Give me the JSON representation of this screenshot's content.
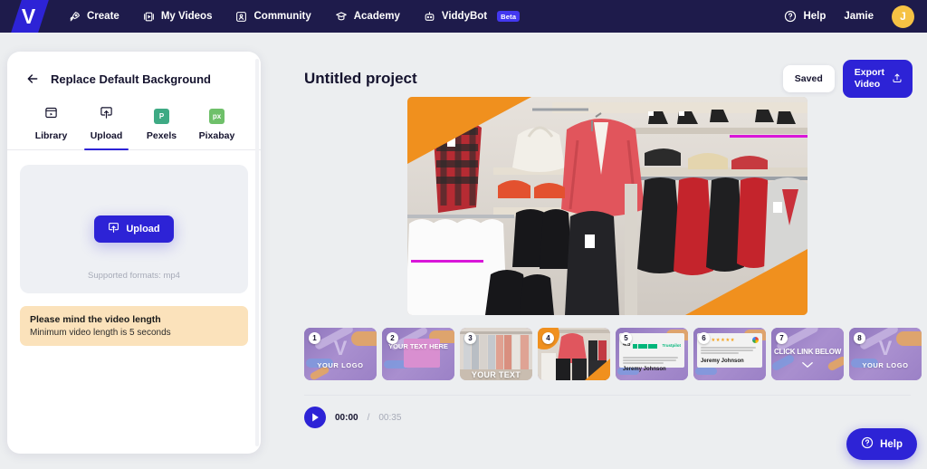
{
  "brand": {
    "logo_letter": "V",
    "accent": "#2d23d6",
    "nav_bg": "#1e1b4b"
  },
  "topnav": {
    "items": [
      {
        "label": "Create",
        "icon": "rocket-icon"
      },
      {
        "label": "My Videos",
        "icon": "video-library-icon"
      },
      {
        "label": "Community",
        "icon": "community-icon"
      },
      {
        "label": "Academy",
        "icon": "graduation-cap-icon"
      },
      {
        "label": "ViddyBot",
        "icon": "robot-icon",
        "badge": "Beta"
      }
    ],
    "help_label": "Help",
    "user_name": "Jamie",
    "user_initial": "J"
  },
  "left_panel": {
    "title": "Replace Default Background",
    "back_icon": "arrow-left-icon",
    "tabs": [
      {
        "label": "Library",
        "icon": "library-icon",
        "active": false
      },
      {
        "label": "Upload",
        "icon": "upload-icon",
        "active": true
      },
      {
        "label": "Pexels",
        "icon": "pexels-icon",
        "active": false
      },
      {
        "label": "Pixabay",
        "icon": "pixabay-icon",
        "active": false
      }
    ],
    "dropzone": {
      "button_label": "Upload",
      "button_icon": "upload-icon",
      "supported_formats": "Supported formats: mp4"
    },
    "warning": {
      "title": "Please mind the video length",
      "subtitle": "Minimum video length is 5 seconds",
      "bg": "#fbe2bb"
    }
  },
  "main": {
    "project_title": "Untitled project",
    "saved_label": "Saved",
    "export_line1": "Export",
    "export_line2": "Video",
    "export_icon": "export-upload-icon",
    "preview": {
      "description": "Retail clothing store interior with racks of shirts, jackets and trousers",
      "overlay_color": "#f0901e",
      "accent_line_color": "#d916d9"
    },
    "timeline": [
      {
        "num": "1",
        "kind": "promo-logo",
        "text": "YOUR LOGO"
      },
      {
        "num": "2",
        "kind": "promo-text",
        "text": "YOUR TEXT HERE"
      },
      {
        "num": "3",
        "kind": "photo-rack",
        "text": "YOUR TEXT"
      },
      {
        "num": "4",
        "kind": "photo-store",
        "text": ""
      },
      {
        "num": "5",
        "kind": "review-trustpilot",
        "score": "4.5",
        "platform": "Trustpilot",
        "reviewer": "Jeremy Johnson"
      },
      {
        "num": "6",
        "kind": "review-google",
        "score": "4.5",
        "platform": "Google",
        "reviewer": "Jeremy Johnson"
      },
      {
        "num": "7",
        "kind": "promo-cta",
        "text": "CLICK LINK BELOW"
      },
      {
        "num": "8",
        "kind": "promo-logo",
        "text": "YOUR LOGO"
      }
    ],
    "player": {
      "play_icon": "play-icon",
      "current_time": "00:00",
      "separator": "/",
      "total_time": "00:35"
    },
    "help_fab": {
      "label": "Help",
      "icon": "help-circle-icon"
    }
  }
}
